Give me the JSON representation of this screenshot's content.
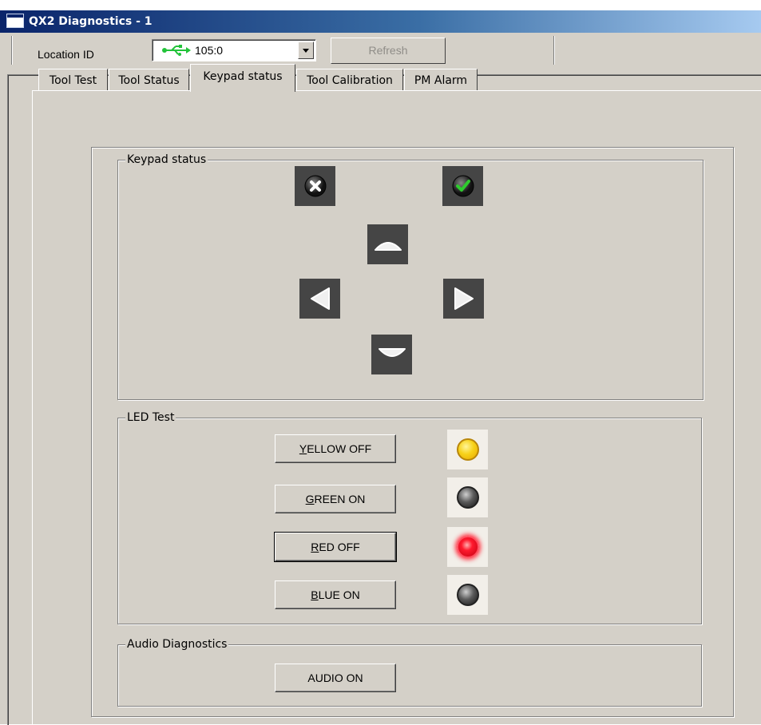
{
  "window": {
    "title": "QX2 Diagnostics - 1"
  },
  "toolbar": {
    "location_label": "Location ID",
    "location_value": "105:0",
    "refresh_label": "Refresh"
  },
  "tabs": [
    {
      "label": "Tool Test",
      "active": false
    },
    {
      "label": "Tool Status",
      "active": false
    },
    {
      "label": "Keypad status",
      "active": true
    },
    {
      "label": "Tool Calibration",
      "active": false
    },
    {
      "label": "PM Alarm",
      "active": false
    }
  ],
  "keypad": {
    "legend": "Keypad status",
    "keys": [
      "cancel-key",
      "ok-key",
      "up-key",
      "left-key",
      "right-key",
      "down-key"
    ]
  },
  "led_test": {
    "legend": "LED Test",
    "rows": [
      {
        "mnemonic": "Y",
        "rest": "ELLOW OFF",
        "led_color": "#f7d21a",
        "lit": true
      },
      {
        "mnemonic": "G",
        "rest": "REEN ON",
        "led_color": "#2b2b2b",
        "lit": false
      },
      {
        "mnemonic": "R",
        "rest": "ED OFF",
        "led_color": "#e4001b",
        "lit": true
      },
      {
        "mnemonic": "B",
        "rest": "LUE ON",
        "led_color": "#2b2b2b",
        "lit": false
      }
    ]
  },
  "audio": {
    "legend": "Audio Diagnostics",
    "button_label": "AUDIO ON"
  },
  "colors": {
    "title_bar_start": "#0a246a",
    "title_bar_end": "#a6caf0",
    "window_bg": "#d4d0c8",
    "usb_icon": "#22c33a"
  }
}
